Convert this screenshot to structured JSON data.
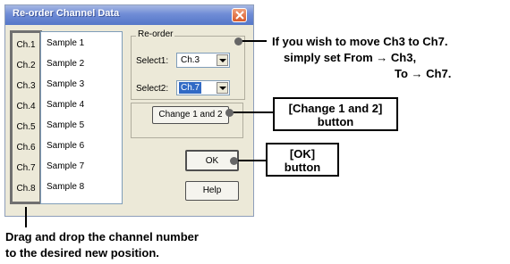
{
  "dialog": {
    "title": "Re-order Channel Data",
    "channels": [
      "Ch.1",
      "Ch.2",
      "Ch.3",
      "Ch.4",
      "Ch.5",
      "Ch.6",
      "Ch.7",
      "Ch.8"
    ],
    "samples": [
      "Sample 1",
      "Sample 2",
      "Sample 3",
      "Sample 4",
      "Sample 5",
      "Sample 6",
      "Sample 7",
      "Sample 8"
    ],
    "reorder_group_label": "Re-order",
    "select1_label": "Select1:",
    "select1_value": "Ch.3",
    "select2_label": "Select2:",
    "select2_value": "Ch.7",
    "change_button_label": "Change 1 and 2",
    "ok_button_label": "OK",
    "help_button_label": "Help"
  },
  "annotations": {
    "move_line1": "If you wish to move Ch3 to Ch7.",
    "move_line2": "simply set From → Ch3,",
    "move_line3": "To → Ch7.",
    "change_callout_line1": "[Change 1 and 2]",
    "change_callout_line2": "button",
    "ok_callout_line1": "[OK]",
    "ok_callout_line2": "button",
    "drag_line1": "Drag and drop the channel number",
    "drag_line2": "to the desired new position."
  }
}
